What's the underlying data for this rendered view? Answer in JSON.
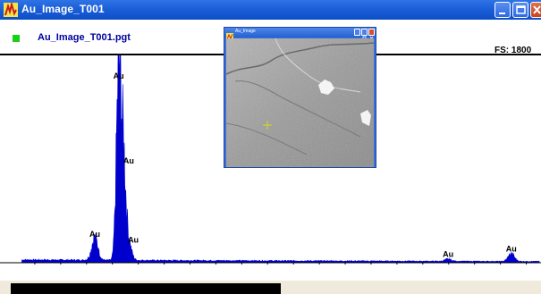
{
  "window": {
    "title": "Au_Image_T001",
    "icon": "spectrum-app-icon"
  },
  "titlebar_buttons": [
    "minimize-icon",
    "maximize-icon",
    "close-icon"
  ],
  "header": {
    "file_name": "Au_Image_T001.pgt",
    "full_scale": "FS: 1800",
    "indicator_color": "#18d018"
  },
  "inset_window": {
    "title": "Au_Image",
    "buttons": [
      "minimize-icon",
      "maximize-icon",
      "close-icon"
    ],
    "image": "sem-micrograph",
    "marker": "crosshair-icon"
  },
  "chart_data": {
    "type": "line",
    "title": "",
    "xlabel": "",
    "ylabel": "",
    "xlim": [
      0,
      10.25
    ],
    "ylim": [
      0,
      1800
    ],
    "x_ticks": [
      "2",
      "4",
      "6",
      "8",
      "10"
    ],
    "series_color": "#0000cc",
    "peaks": [
      {
        "x": 1.66,
        "y": 210,
        "label": "Au"
      },
      {
        "x": 2.12,
        "y": 1700,
        "label": "Au"
      },
      {
        "x": 2.21,
        "y": 900,
        "label": "Au"
      },
      {
        "x": 2.3,
        "y": 190,
        "label": "Au"
      },
      {
        "x": 8.49,
        "y": 20,
        "label": "Au"
      },
      {
        "x": 9.71,
        "y": 70,
        "label": "Au"
      }
    ],
    "background_counts": 25
  }
}
